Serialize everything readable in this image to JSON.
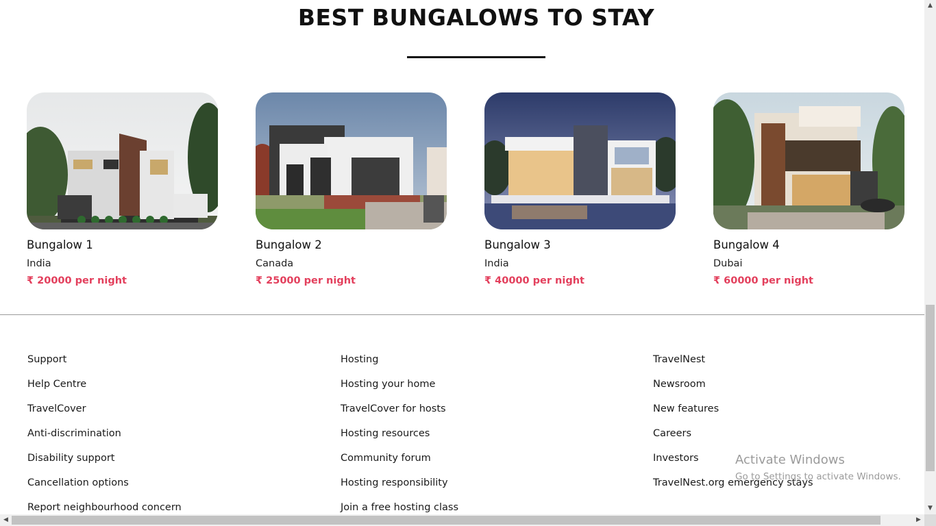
{
  "section": {
    "title": "BEST BUNGALOWS TO STAY"
  },
  "bungalows": [
    {
      "name": "Bungalow 1",
      "location": "India",
      "price": "₹ 20000 per night"
    },
    {
      "name": "Bungalow 2",
      "location": "Canada",
      "price": "₹ 25000 per night"
    },
    {
      "name": "Bungalow 3",
      "location": "India",
      "price": "₹ 40000 per night"
    },
    {
      "name": "Bungalow 4",
      "location": "Dubai",
      "price": "₹ 60000 per night"
    }
  ],
  "footer": {
    "columns": [
      {
        "items": [
          "Support",
          "Help Centre",
          "TravelCover",
          "Anti-discrimination",
          "Disability support",
          "Cancellation options",
          "Report neighbourhood concern"
        ]
      },
      {
        "items": [
          "Hosting",
          "Hosting your home",
          "TravelCover for hosts",
          "Hosting resources",
          "Community forum",
          "Hosting responsibility",
          "Join a free hosting class"
        ]
      },
      {
        "items": [
          "TravelNest",
          "Newsroom",
          "New features",
          "Careers",
          "Investors",
          "TravelNest.org emergency stays"
        ]
      }
    ]
  },
  "watermark": {
    "line1": "Activate Windows",
    "line2": "Go to Settings to activate Windows."
  },
  "colors": {
    "price": "#e3405d",
    "divider": "#9a9a9a",
    "text": "#1a1a1a"
  },
  "icons": {
    "scroll_up": "chevron-up-icon",
    "scroll_down": "chevron-down-icon",
    "scroll_left": "chevron-left-icon",
    "scroll_right": "chevron-right-icon"
  }
}
